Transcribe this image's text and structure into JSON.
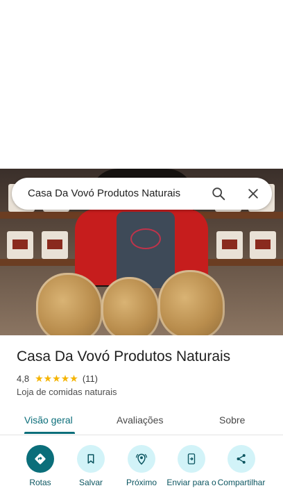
{
  "search": {
    "query": "Casa Da Vovó Produtos Naturais"
  },
  "place": {
    "name": "Casa Da Vovó Produtos Naturais",
    "rating": "4,8",
    "stars": "★★★★★",
    "review_count": "(11)",
    "category": "Loja de comidas naturais"
  },
  "tabs": [
    {
      "label": "Visão geral",
      "active": true
    },
    {
      "label": "Avaliações",
      "active": false
    },
    {
      "label": "Sobre",
      "active": false
    }
  ],
  "actions": [
    {
      "label": "Rotas",
      "icon": "directions-icon"
    },
    {
      "label": "Salvar",
      "icon": "bookmark-icon"
    },
    {
      "label": "Próximo",
      "icon": "nearby-icon"
    },
    {
      "label": "Enviar para o",
      "icon": "send-to-phone-icon"
    },
    {
      "label": "Compartilhar",
      "icon": "share-icon"
    }
  ],
  "colors": {
    "accent": "#0b6e7a",
    "action_bg": "#d2f3f8",
    "star": "#f5b400"
  }
}
